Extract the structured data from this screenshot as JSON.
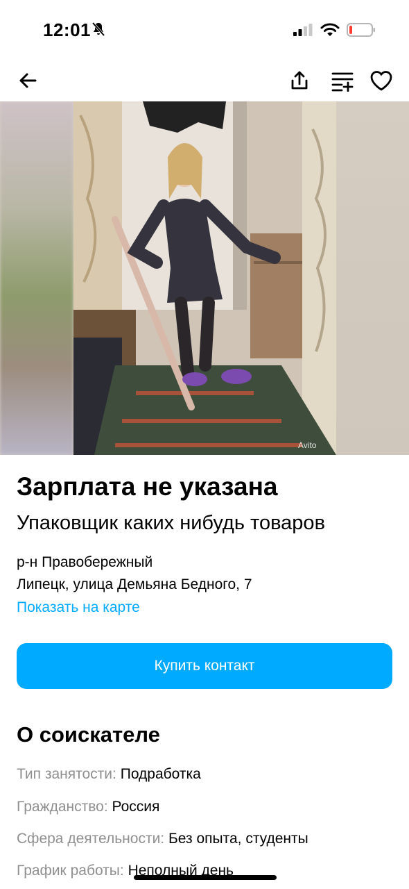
{
  "status": {
    "time": "12:01"
  },
  "gallery": {
    "watermark": "Avito"
  },
  "listing": {
    "salary": "Зарплата не указана",
    "title": "Упаковщик каких нибудь товаров",
    "district": "р-н Правобережный",
    "address": "Липецк, улица Демьяна Бедного, 7",
    "map_link": "Показать на карте",
    "buy_button": "Купить контакт"
  },
  "about": {
    "heading": "О соискателе",
    "rows": [
      {
        "label": "Тип занятости:",
        "value": "Подработка"
      },
      {
        "label": "Гражданство:",
        "value": "Россия"
      },
      {
        "label": "Сфера деятельности:",
        "value": "Без опыта, студенты"
      },
      {
        "label": "График работы:",
        "value": "Неполный день"
      }
    ]
  },
  "colors": {
    "accent": "#00aaff",
    "muted": "#8f8f8f"
  }
}
